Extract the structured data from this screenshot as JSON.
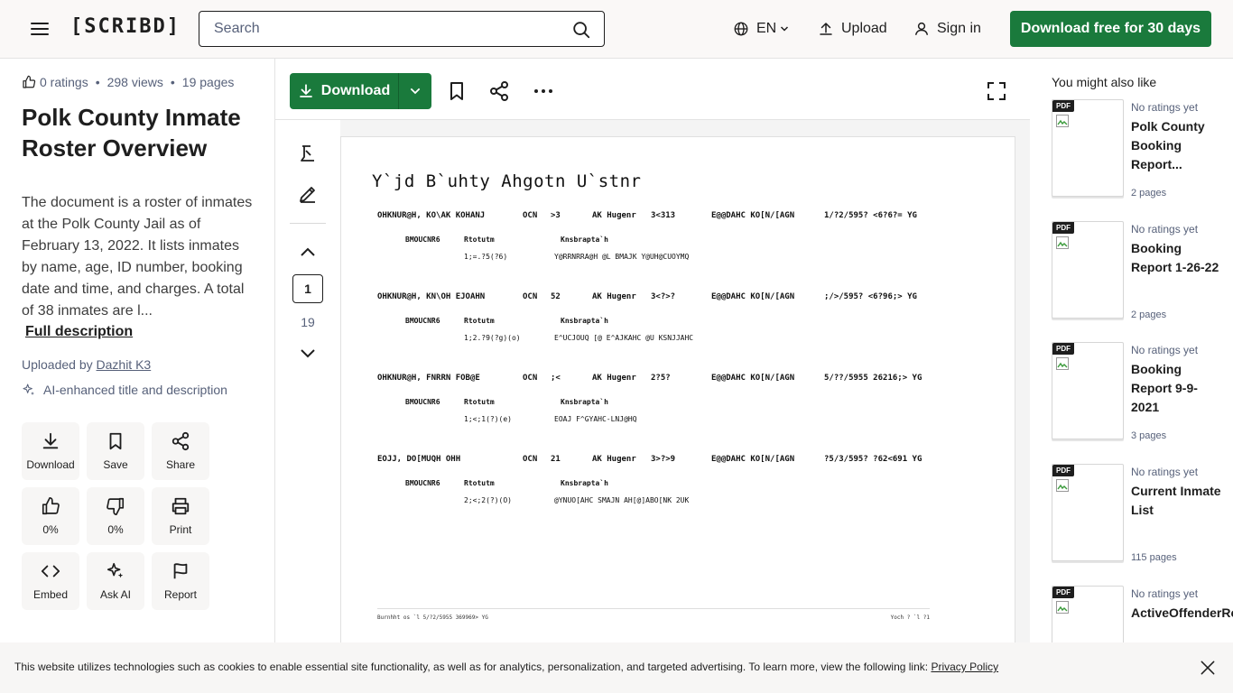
{
  "header": {
    "logo": "[SCRIBD]",
    "search_placeholder": "Search",
    "language": "EN",
    "upload": "Upload",
    "sign_in": "Sign in",
    "cta": "Download free for 30 days"
  },
  "doc": {
    "ratings": "0 ratings",
    "views": "298 views",
    "pages": "19 pages",
    "title": "Polk County Inmate Roster Overview",
    "description": "The document is a roster of inmates at the Polk County Jail as of February 13, 2022. It lists inmates by name, age, ID number, booking date and time, and charges. A total of 38 inmates are l...",
    "full_description": "Full description",
    "uploaded_by_label": "Uploaded by",
    "uploader": "Dazhit K3",
    "ai_note": "AI-enhanced title and description"
  },
  "actions": [
    {
      "label": "Download",
      "icon": "download-icon"
    },
    {
      "label": "Save",
      "icon": "bookmark-icon"
    },
    {
      "label": "Share",
      "icon": "share-icon"
    },
    {
      "label": "0%",
      "icon": "thumbs-up-icon"
    },
    {
      "label": "0%",
      "icon": "thumbs-down-icon"
    },
    {
      "label": "Print",
      "icon": "print-icon"
    },
    {
      "label": "Embed",
      "icon": "embed-icon"
    },
    {
      "label": "Ask AI",
      "icon": "sparkle-icon"
    },
    {
      "label": "Report",
      "icon": "flag-icon"
    }
  ],
  "viewer": {
    "download": "Download",
    "current_page": "1",
    "total_pages": "19",
    "page_title": "Y`jd B`uhty Ahgotn U`stnr",
    "records": [
      {
        "name": "OHKNUR@H, KO\\AK KOHANJ",
        "ocn_label": "OCN",
        "ocn": ">3",
        "ak_label": "AK Hugenr",
        "ak": "3<313",
        "date_label": "E@@DAHC KO[N/[AGN",
        "date": "1/?2/595? <6?6?= YG",
        "col1": "BMOUCNR6",
        "col2": "Rtotutm",
        "col3": "Knsbrapta`h",
        "v2": "1;=.?5(?6)",
        "v3": "Y@RRNRRA@H @L BMAJK Y@UH@CUOYMQ"
      },
      {
        "name": "OHKNUR@H, KN\\OH EJOAHN",
        "ocn_label": "OCN",
        "ocn": "52",
        "ak_label": "AK Hugenr",
        "ak": "3<?>?",
        "date_label": "E@@DAHC KO[N/[AGN",
        "date": ";/>/595? <6?96;> YG",
        "col1": "BMOUCNR6",
        "col2": "Rtotutm",
        "col3": "Knsbrapta`h",
        "v2": "1;2.?9(?g)(o)",
        "v3": "E^UCJOUQ [@ E^AJKAHC @U KSNJJAHC"
      },
      {
        "name": "OHKNUR@H, FNRRN FOB@E",
        "ocn_label": "OCN",
        "ocn": ";<",
        "ak_label": "AK Hugenr",
        "ak": "2?5?",
        "date_label": "E@@DAHC KO[N/[AGN",
        "date": "5/??/5955 26216;> YG",
        "col1": "BMOUCNR6",
        "col2": "Rtotutm",
        "col3": "Knsbrapta`h",
        "v2": "1;<;1(?)(e)",
        "v3": "EOAJ F^GYAHC-LNJ@HQ"
      },
      {
        "name": "EOJJ, DO[MUQH OHH",
        "ocn_label": "OCN",
        "ocn": "21",
        "ak_label": "AK Hugenr",
        "ak": "3>?>9",
        "date_label": "E@@DAHC KO[N/[AGN",
        "date": "?5/3/595? ?62<691 YG",
        "col1": "BMOUCNR6",
        "col2": "Rtotutm",
        "col3": "Knsbrapta`h",
        "v2": "2;<;2(?)(O)",
        "v3": "@YNUO[AHC SMAJN AH[@]ABO[NK 2UK"
      }
    ],
    "footer_left": "Burnhht os `l  5/?2/5955 369969> YG",
    "footer_right": "Yoch ? `l ?1"
  },
  "rail": {
    "heading": "You might also like",
    "items": [
      {
        "badge": "PDF",
        "rating": "No ratings yet",
        "title": "Polk County Booking Report...",
        "pages": "2 pages"
      },
      {
        "badge": "PDF",
        "rating": "No ratings yet",
        "title": "Booking Report 1-26-22",
        "pages": "2 pages"
      },
      {
        "badge": "PDF",
        "rating": "No ratings yet",
        "title": "Booking Report 9-9-2021",
        "pages": "3 pages"
      },
      {
        "badge": "PDF",
        "rating": "No ratings yet",
        "title": "Current Inmate List",
        "pages": "115 pages"
      },
      {
        "badge": "PDF",
        "rating": "No ratings yet",
        "title": "ActiveOffenderReport",
        "pages": ""
      }
    ]
  },
  "cookie": {
    "text": "This website utilizes technologies such as cookies to enable essential site functionality, as well as for analytics, personalization, and targeted advertising. To learn more, view the following link: ",
    "link": "Privacy Policy"
  },
  "colors": {
    "brand_green": "#1a7a3c",
    "text": "#1e1e1e",
    "muted": "#57617a",
    "header_bg": "#faf8f7"
  }
}
